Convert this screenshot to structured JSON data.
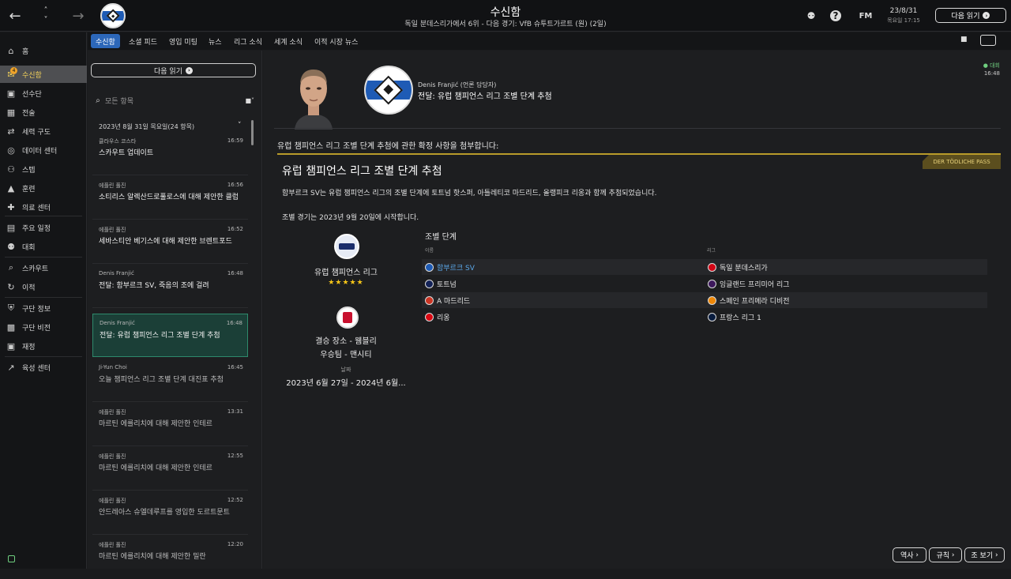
{
  "topbar": {
    "title": "수신함",
    "subtitle": "독일 분데스리가에서 6위 - 다음 경기: VfB 슈투트가르트 (원) (2일)",
    "fm_label": "FM",
    "date": "23/8/31",
    "time": "목요일 17:15",
    "next_label": "다음 읽기",
    "back_icon": "arrow-left-icon",
    "help_label": "?"
  },
  "sidebar": {
    "badge": "4",
    "items": [
      {
        "label": "홈",
        "icon": "home-icon"
      },
      {
        "label": "수신함",
        "icon": "inbox-icon"
      },
      {
        "label": "선수단",
        "icon": "shirt-icon"
      },
      {
        "label": "전술",
        "icon": "tactics-icon"
      },
      {
        "label": "세력 구도",
        "icon": "dynamics-icon"
      },
      {
        "label": "데이터 센터",
        "icon": "data-icon"
      },
      {
        "label": "스텝",
        "icon": "staff-icon"
      },
      {
        "label": "훈련",
        "icon": "training-icon"
      },
      {
        "label": "의료 센터",
        "icon": "medical-icon"
      },
      {
        "label": "주요 일정",
        "icon": "calendar-icon"
      },
      {
        "label": "대회",
        "icon": "trophy-icon"
      },
      {
        "label": "스카우트",
        "icon": "scout-icon"
      },
      {
        "label": "이적",
        "icon": "transfer-icon"
      },
      {
        "label": "구단 정보",
        "icon": "shield-icon"
      },
      {
        "label": "구단 비전",
        "icon": "vision-icon"
      },
      {
        "label": "재정",
        "icon": "finance-icon"
      },
      {
        "label": "육성 센터",
        "icon": "youth-icon"
      }
    ]
  },
  "tabs": [
    "수신함",
    "소셜 피드",
    "영입 미팅",
    "뉴스",
    "리그 소식",
    "세계 소식",
    "이적 시장 뉴스"
  ],
  "inbox": {
    "next_label": "다음 읽기",
    "search_placeholder": "모든 항목",
    "date_header": "2023년 8월 31일 목요일(24 항목)",
    "messages": [
      {
        "from": "클라우스 코스타",
        "time": "16:59",
        "subject": "스카우트 업데이트"
      },
      {
        "from": "에플린 풀진",
        "time": "16:56",
        "subject": "소티리스 알렉산드로풀로스에 대해 제안한 클럽"
      },
      {
        "from": "에플린 풀진",
        "time": "16:52",
        "subject": "세바스티안 베기스에 대해 제안한 브렌트포드"
      },
      {
        "from": "Denis Franjić",
        "time": "16:48",
        "subject": "전달: 함부르크 SV, 죽음의 조에 걸려"
      },
      {
        "from": "Denis Franjić",
        "time": "16:48",
        "subject": "전달: 유럽 챔피언스 리그 조별 단계 추첨"
      },
      {
        "from": "Ji-Yun Choi",
        "time": "16:45",
        "subject": "오늘 챔피언스 리그 조별 단계 대진표 추첨"
      },
      {
        "from": "에플린 풀진",
        "time": "13:31",
        "subject": "마르틴 에를리치에 대해 제안한 인테르"
      },
      {
        "from": "에플린 풀진",
        "time": "12:55",
        "subject": "마르틴 에를리치에 대해 제안한 인테르"
      },
      {
        "from": "에플린 풀진",
        "time": "12:52",
        "subject": "안드레아스 슈엘데루프를 영입한 도르트문트"
      },
      {
        "from": "에플린 풀진",
        "time": "12:20",
        "subject": "마르틴 에를리치에 대해 제안한 밀란"
      }
    ]
  },
  "message": {
    "sender_name": "Denis Franjić  (언론 담당자)",
    "subject": "전달: 유럽 챔피언스 리그 조별 단계 추첨",
    "competition_tag": "대회",
    "time": "16:48",
    "intro": "유럽 챔피언스 리그 조별 단계 추첨에 관한 확정 사항을 첨부합니다:",
    "source_tag": "DER TÖDLICHE PASS",
    "headline": "유럽 챔피언스 리그 조별 단계 추첨",
    "body1": "함부르크 SV는 유럽 챔피언스 리그의 조별 단계에 토트넘 핫스퍼, 아틀레티코 마드리드, 올랭피크 리옹과 함께 추첨되었습니다.",
    "body2": "조별 경기는 2023년 9월 20일에 시작합니다.",
    "card": {
      "competition": "유럽 챔피언스 리그",
      "stars": "★★★★★",
      "venue": "결승 장소 - 웸블리",
      "winner": "우승팀 - 맨시티",
      "date_label": "날짜",
      "date": "2023년 6월 27일 - 2024년 6월..."
    },
    "group": {
      "title": "조별 단계",
      "col_name": "이름",
      "col_league": "리그",
      "rows": [
        {
          "team": "함부르크 SV",
          "league": "독일 분데스리가",
          "team_color": "#1e5bb5",
          "league_color": "#d20515"
        },
        {
          "team": "토트넘",
          "league": "잉글랜드 프리미어 리그",
          "team_color": "#132257",
          "league_color": "#3d185c"
        },
        {
          "team": "A 마드리드",
          "league": "스페인 프리메라 디비전",
          "team_color": "#cb3524",
          "league_color": "#ee8707"
        },
        {
          "team": "리옹",
          "league": "프랑스 리그 1",
          "team_color": "#da0812",
          "league_color": "#091c3e"
        }
      ]
    }
  },
  "bottom": {
    "history": "역사",
    "rules": "규칙",
    "more": "조 보기"
  }
}
